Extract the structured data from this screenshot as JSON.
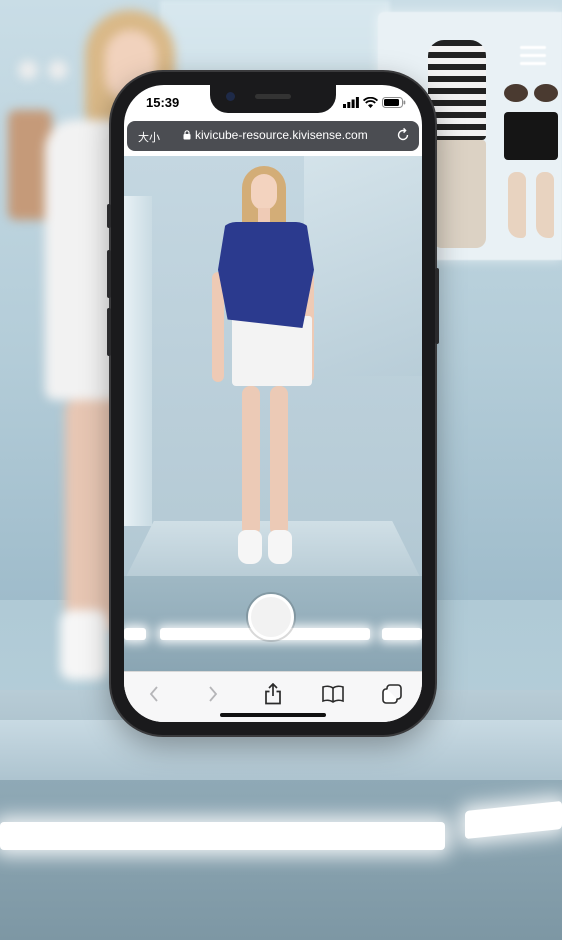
{
  "status_bar": {
    "time": "15:39"
  },
  "browser": {
    "text_size_button": "大小",
    "url": "kivicube-resource.kivisense.com"
  },
  "toolbar": {
    "back_icon": "chevron-left-icon",
    "forward_icon": "chevron-right-icon",
    "share_icon": "share-icon",
    "bookmarks_icon": "book-icon",
    "tabs_icon": "tabs-icon"
  },
  "colors": {
    "top": "#2b3a8e",
    "skirt": "#f3f3f3",
    "url_bar": "#4b4d52",
    "scene": "#b6cbd6"
  }
}
